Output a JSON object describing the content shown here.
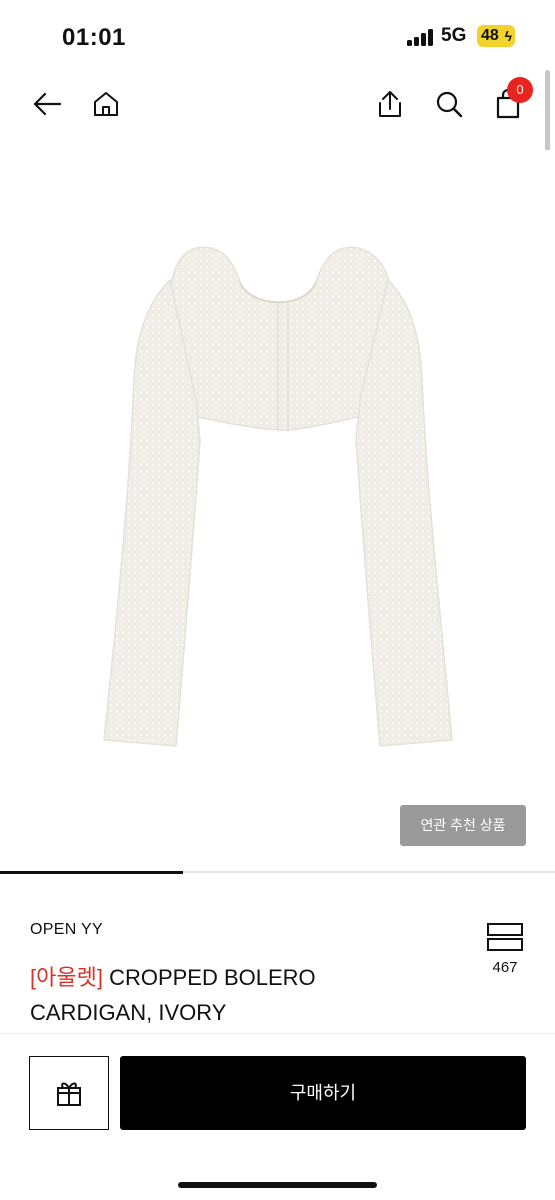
{
  "status_bar": {
    "time": "01:01",
    "network": "5G",
    "battery": "48"
  },
  "nav": {
    "cart_count": "0"
  },
  "icons": [
    "back-arrow-icon",
    "home-icon",
    "share-icon",
    "search-icon",
    "shopping-bag-icon",
    "like-icon",
    "gift-icon"
  ],
  "product": {
    "recommend_label": "연관 추천 상품",
    "brand": "OPEN YY",
    "title_tag": "[아울렛]",
    "title": " CROPPED BOLERO CARDIGAN, IVORY",
    "like_count": "467",
    "image_index_progress": 0.33
  },
  "actions": {
    "buy_label": "구매하기"
  },
  "colors": {
    "tag_red": "#d8332a",
    "badge_red": "#e8241f",
    "button_black": "#000000",
    "recommend_gray": "#9a9a9a"
  }
}
